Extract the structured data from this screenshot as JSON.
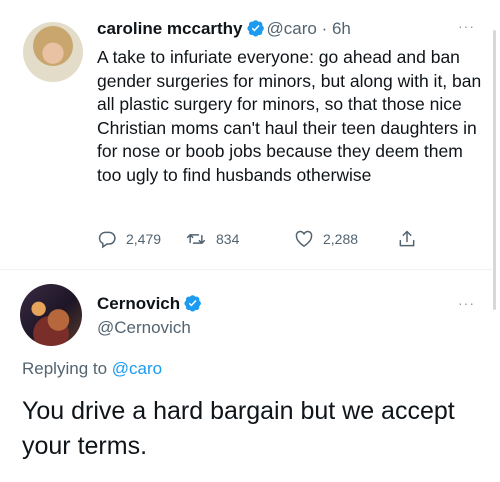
{
  "tweet": {
    "author_name": "caroline mccarthy",
    "handle": "@caro",
    "separator": " · ",
    "time": "6h",
    "more": "···",
    "text": "A take to infuriate everyone: go ahead and ban gender surgeries for minors, but along with it, ban all plastic surgery for minors, so that those nice Christian moms can't haul their teen daughters in for nose or boob jobs because they deem them too ugly to find husbands otherwise",
    "replies": "2,479",
    "retweets": "834",
    "likes": "2,288"
  },
  "reply": {
    "author_name": "Cernovich",
    "handle": "@Cernovich",
    "more": "···",
    "replying_prefix": "Replying to ",
    "replying_to": "@caro",
    "text": "You drive a hard bargain but we accept your terms."
  },
  "icons": {
    "verified": "verified-badge-icon",
    "reply": "reply-icon",
    "retweet": "retweet-icon",
    "like": "heart-icon",
    "share": "share-icon"
  },
  "colors": {
    "verified": "#1d9bf0",
    "link": "#1d9bf0",
    "secondary_text": "#536471"
  }
}
